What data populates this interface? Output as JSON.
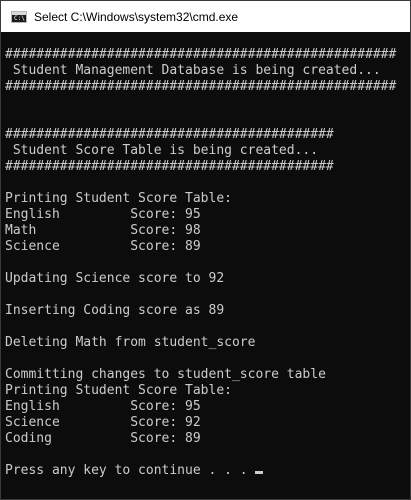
{
  "window": {
    "title": "Select C:\\Windows\\system32\\cmd.exe",
    "icon": "cmd-console-icon",
    "icon_glyph": "C:\\"
  },
  "console": {
    "lines": [
      "##################################################",
      " Student Management Database is being created...",
      "##################################################",
      "",
      "",
      "##########################################",
      " Student Score Table is being created...",
      "##########################################",
      "",
      "Printing Student Score Table:",
      "English         Score: 95",
      "Math            Score: 98",
      "Science         Score: 89",
      "",
      "Updating Science score to 92",
      "",
      "Inserting Coding score as 89",
      "",
      "Deleting Math from student_score",
      "",
      "Committing changes to student_score table",
      "Printing Student Score Table:",
      "English         Score: 95",
      "Science         Score: 92",
      "Coding          Score: 89",
      "",
      "Press any key to continue . . . "
    ]
  }
}
